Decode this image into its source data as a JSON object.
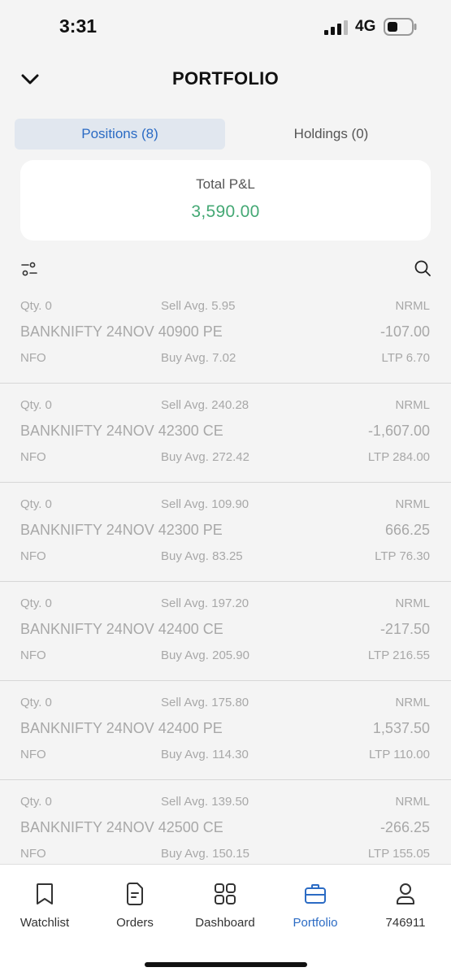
{
  "status_bar": {
    "time": "3:31",
    "network": "4G"
  },
  "header": {
    "title": "PORTFOLIO"
  },
  "tabs": [
    {
      "label": "Positions (8)",
      "active": true
    },
    {
      "label": "Holdings (0)",
      "active": false
    }
  ],
  "summary": {
    "label": "Total P&L",
    "value": "3,590.00",
    "value_color": "#44a874"
  },
  "positions": [
    {
      "qty": "Qty. 0",
      "sell_avg": "Sell Avg. 5.95",
      "product": "NRML",
      "symbol": "BANKNIFTY 24NOV 40900 PE",
      "pnl": "-107.00",
      "exchange": "NFO",
      "buy_avg": "Buy Avg. 7.02",
      "ltp": "LTP 6.70"
    },
    {
      "qty": "Qty. 0",
      "sell_avg": "Sell Avg. 240.28",
      "product": "NRML",
      "symbol": "BANKNIFTY 24NOV 42300 CE",
      "pnl": "-1,607.00",
      "exchange": "NFO",
      "buy_avg": "Buy Avg. 272.42",
      "ltp": "LTP 284.00"
    },
    {
      "qty": "Qty. 0",
      "sell_avg": "Sell Avg. 109.90",
      "product": "NRML",
      "symbol": "BANKNIFTY 24NOV 42300 PE",
      "pnl": "666.25",
      "exchange": "NFO",
      "buy_avg": "Buy Avg. 83.25",
      "ltp": "LTP 76.30"
    },
    {
      "qty": "Qty. 0",
      "sell_avg": "Sell Avg. 197.20",
      "product": "NRML",
      "symbol": "BANKNIFTY 24NOV 42400 CE",
      "pnl": "-217.50",
      "exchange": "NFO",
      "buy_avg": "Buy Avg. 205.90",
      "ltp": "LTP 216.55"
    },
    {
      "qty": "Qty. 0",
      "sell_avg": "Sell Avg. 175.80",
      "product": "NRML",
      "symbol": "BANKNIFTY 24NOV 42400 PE",
      "pnl": "1,537.50",
      "exchange": "NFO",
      "buy_avg": "Buy Avg. 114.30",
      "ltp": "LTP 110.00"
    },
    {
      "qty": "Qty. 0",
      "sell_avg": "Sell Avg. 139.50",
      "product": "NRML",
      "symbol": "BANKNIFTY 24NOV 42500 CE",
      "pnl": "-266.25",
      "exchange": "NFO",
      "buy_avg": "Buy Avg. 150.15",
      "ltp": "LTP 155.05"
    }
  ],
  "nav": [
    {
      "label": "Watchlist",
      "icon": "bookmark-icon",
      "active": false
    },
    {
      "label": "Orders",
      "icon": "document-icon",
      "active": false
    },
    {
      "label": "Dashboard",
      "icon": "grid-icon",
      "active": false
    },
    {
      "label": "Portfolio",
      "icon": "briefcase-icon",
      "active": true
    },
    {
      "label": "746911",
      "icon": "user-icon",
      "active": false
    }
  ],
  "colors": {
    "accent": "#2b6bc4",
    "profit": "#44a874",
    "muted_text": "#a8a8a8"
  }
}
